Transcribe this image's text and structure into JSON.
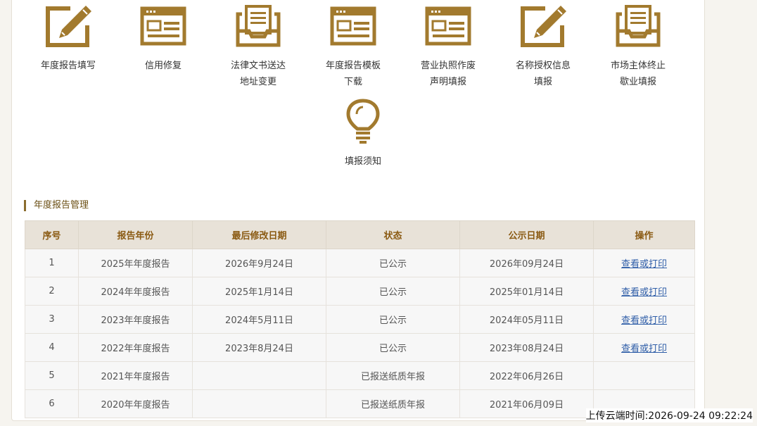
{
  "accent_color": "#a27a2e",
  "tiles": [
    {
      "icon": "pencil-edit-icon",
      "line1": "年度报告填写",
      "line2": ""
    },
    {
      "icon": "browser-window-icon",
      "line1": "信用修复",
      "line2": ""
    },
    {
      "icon": "document-tray-icon",
      "line1": "法律文书送达",
      "line2": "地址变更"
    },
    {
      "icon": "browser-window-icon",
      "line1": "年度报告模板",
      "line2": "下载"
    },
    {
      "icon": "browser-window-icon",
      "line1": "营业执照作废",
      "line2": "声明填报"
    },
    {
      "icon": "pencil-edit-icon",
      "line1": "名称授权信息",
      "line2": "填报"
    },
    {
      "icon": "document-tray-icon",
      "line1": "市场主体终止",
      "line2": "歇业填报"
    },
    {
      "icon": "lightbulb-icon",
      "line1": "填报须知",
      "line2": ""
    }
  ],
  "section": {
    "title": "年度报告管理"
  },
  "table": {
    "headers": [
      "序号",
      "报告年份",
      "最后修改日期",
      "状态",
      "公示日期",
      "操作"
    ],
    "rows": [
      [
        "1",
        "2025年年度报告",
        "2026年9月24日",
        "已公示",
        "2026年09月24日",
        "查看或打印"
      ],
      [
        "2",
        "2024年年度报告",
        "2025年1月14日",
        "已公示",
        "2025年01月14日",
        "查看或打印"
      ],
      [
        "3",
        "2023年年度报告",
        "2024年5月11日",
        "已公示",
        "2024年05月11日",
        "查看或打印"
      ],
      [
        "4",
        "2022年年度报告",
        "2023年8月24日",
        "已公示",
        "2023年08月24日",
        "查看或打印"
      ],
      [
        "5",
        "2021年年度报告",
        "",
        "已报送纸质年报",
        "2022年06月26日",
        ""
      ],
      [
        "6",
        "2020年年度报告",
        "",
        "已报送纸质年报",
        "2021年06月09日",
        ""
      ]
    ]
  },
  "upload_time": "上传云端时间:2026-09-24 09:22:24"
}
